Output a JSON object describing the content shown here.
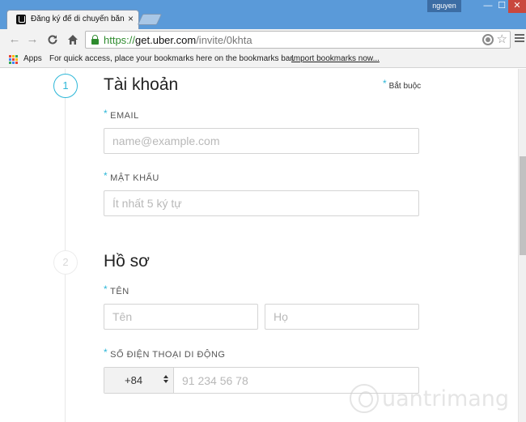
{
  "window": {
    "tab_title": "Đăng ký để di chuyển bằng Uber",
    "tab_close": "×",
    "user_name": "nguyen",
    "min_glyph": "—",
    "max_glyph": "☐",
    "close_glyph": "✕"
  },
  "toolbar": {
    "back_glyph": "←",
    "forward_glyph": "→",
    "reload_glyph": "C",
    "home_glyph": "⌂",
    "url_scheme": "https://",
    "url_host": "get.uber.com",
    "url_path": "/invite/0khta",
    "star_glyph": "☆"
  },
  "bookmarks": {
    "apps_label": "Apps",
    "hint": "For quick access, place your bookmarks here on the bookmarks bar.",
    "import_link": "Import bookmarks now..."
  },
  "form": {
    "required_mark": "*",
    "required_note": "Bắt buộc",
    "section1": {
      "step": "1",
      "title": "Tài khoản",
      "email_label": "EMAIL",
      "email_placeholder": "name@example.com",
      "password_label": "MẬT KHẨU",
      "password_placeholder": "Ít nhất 5 ký tự"
    },
    "section2": {
      "step": "2",
      "title": "Hồ sơ",
      "name_label": "TÊN",
      "first_name_placeholder": "Tên",
      "last_name_placeholder": "Họ",
      "phone_label": "SỐ ĐIỆN THOẠI DI ĐỘNG",
      "country_code": "+84",
      "phone_placeholder": "91 234 56 78"
    }
  },
  "watermark": {
    "text": "uantrimang"
  },
  "colors": {
    "accent": "#2db7d8",
    "secure_green": "#2e8b2e",
    "frame_blue": "#5a9ad9"
  }
}
